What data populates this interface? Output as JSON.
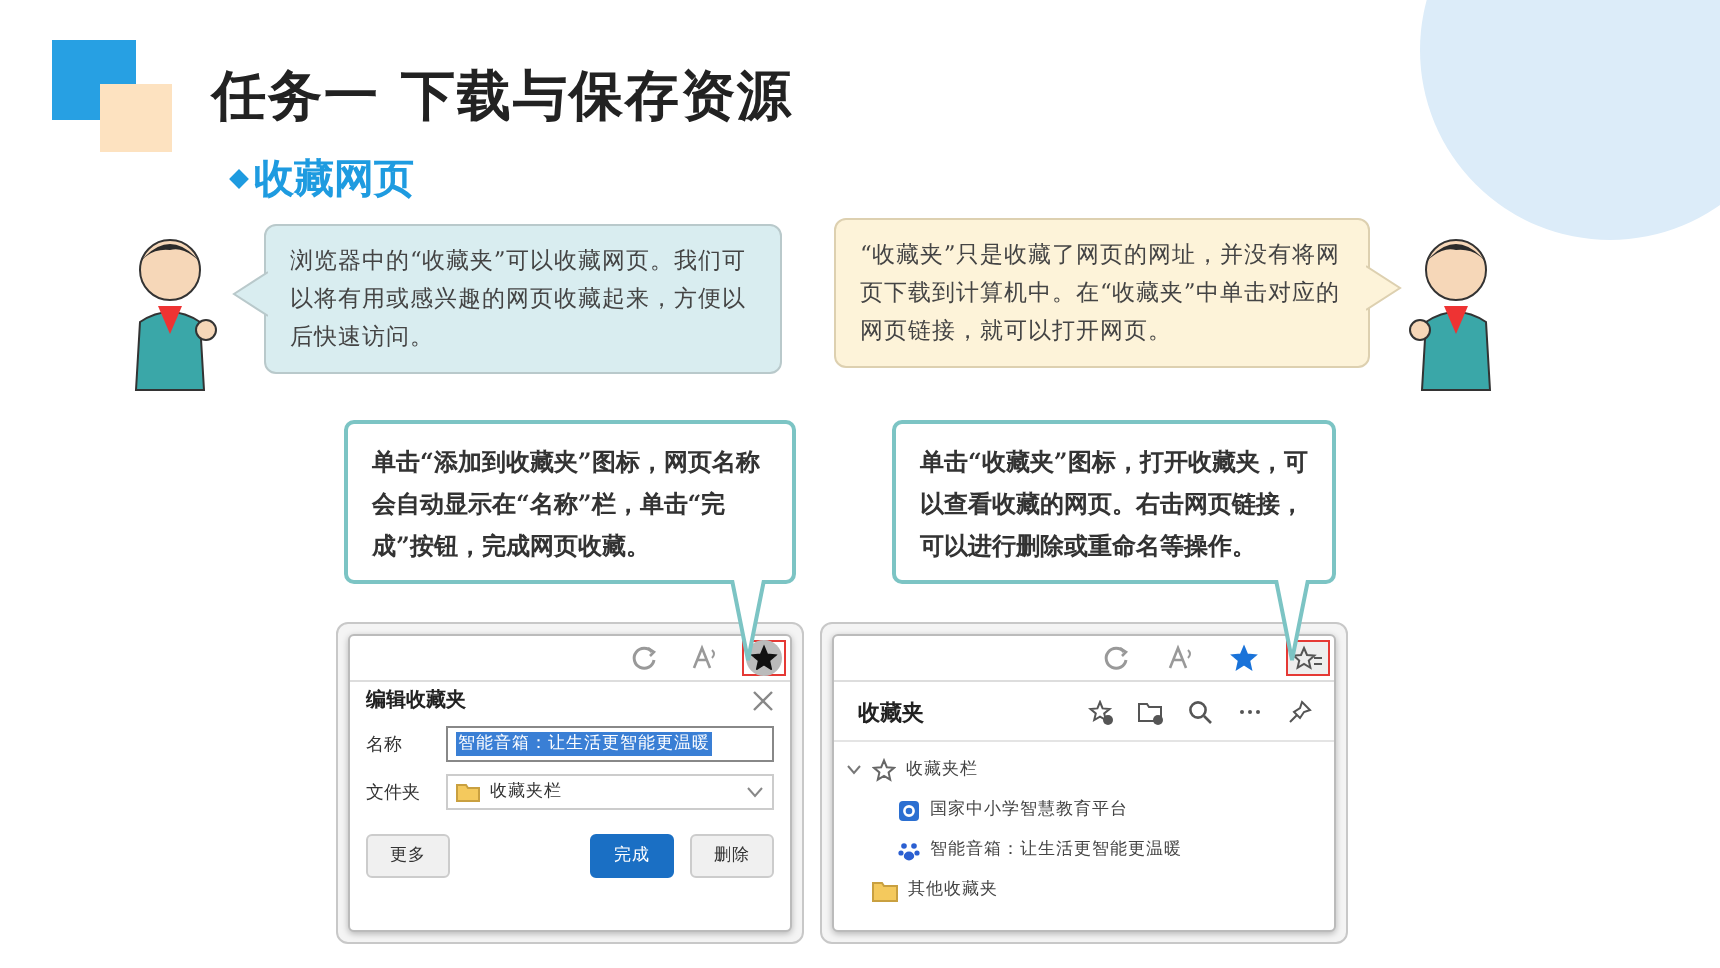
{
  "header": {
    "title": "任务一 下载与保存资源"
  },
  "section": {
    "title": "收藏网页"
  },
  "bubbles": [
    {
      "kind": "left",
      "text": "浏览器中的“收藏夹”可以收藏网页。我们可以将有用或感兴趣的网页收藏起来，方便以后快速访问。"
    },
    {
      "kind": "right",
      "text": "“收藏夹”只是收藏了网页的网址，并没有将网页下载到计算机中。在“收藏夹”中单击对应的网页链接，就可以打开网页。"
    }
  ],
  "callouts": [
    {
      "text": "单击“添加到收藏夹”图标，网页名称会自动显示在“名称”栏，单击“完成”按钮，完成网页收藏。"
    },
    {
      "text": "单击“收藏夹”图标，打开收藏夹，可以查看收藏的网页。右击网页链接，可以进行删除或重命名等操作。"
    }
  ],
  "screenshot_1": {
    "toolbar": [
      {
        "kind": "refresh",
        "highlighted": false
      },
      {
        "kind": "read-aloud",
        "highlighted": false
      },
      {
        "kind": "favorite-added",
        "highlighted": true
      }
    ],
    "dialog": {
      "title": "编辑收藏夹",
      "fields": [
        {
          "kind": "text",
          "label": "名称",
          "value": "智能音箱：让生活更智能更温暖",
          "selected": true
        },
        {
          "kind": "folder",
          "label": "文件夹",
          "value": "收藏夹栏",
          "selected": false
        }
      ],
      "buttons": [
        {
          "label": "更多",
          "primary": false
        },
        {
          "label": "完成",
          "primary": true
        },
        {
          "label": "删除",
          "primary": false
        }
      ]
    }
  },
  "screenshot_2": {
    "toolbar": [
      {
        "kind": "refresh",
        "highlighted": false
      },
      {
        "kind": "read-aloud",
        "highlighted": false
      },
      {
        "kind": "favorite-blue",
        "highlighted": false
      },
      {
        "kind": "favorites-list",
        "highlighted": true
      }
    ],
    "panel": {
      "title": "收藏夹",
      "tree": [
        {
          "kind": "star",
          "label": "收藏夹栏",
          "expanded": true,
          "children": [
            {
              "kind": "site",
              "label": "国家中小学智慧教育平台"
            },
            {
              "kind": "paw",
              "label": "智能音箱：让生活更智能更温暖"
            }
          ]
        },
        {
          "kind": "folder",
          "label": "其他收藏夹"
        }
      ]
    }
  }
}
